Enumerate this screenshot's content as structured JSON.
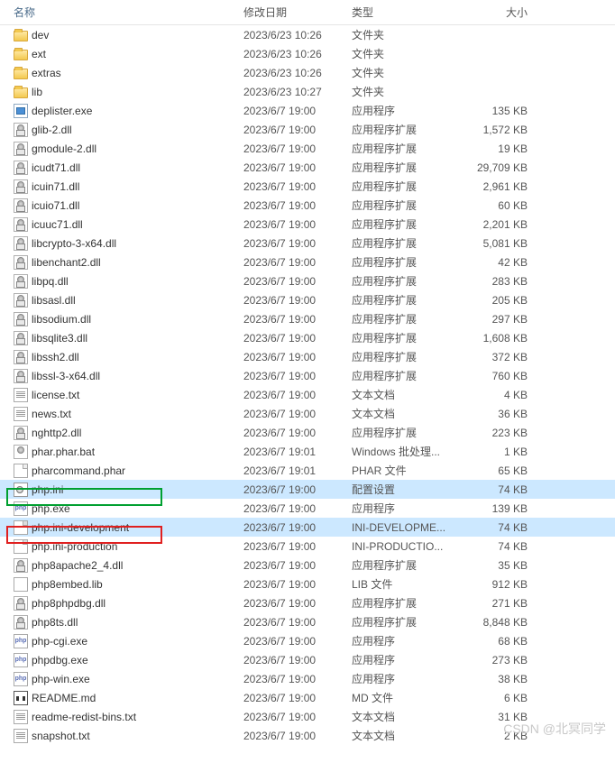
{
  "columns": {
    "name": "名称",
    "date": "修改日期",
    "type": "类型",
    "size": "大小"
  },
  "watermark": "CSDN @北冥同学",
  "files": [
    {
      "name": "dev",
      "date": "2023/6/23 10:26",
      "type": "文件夹",
      "size": "",
      "icon": "folder"
    },
    {
      "name": "ext",
      "date": "2023/6/23 10:26",
      "type": "文件夹",
      "size": "",
      "icon": "folder"
    },
    {
      "name": "extras",
      "date": "2023/6/23 10:26",
      "type": "文件夹",
      "size": "",
      "icon": "folder"
    },
    {
      "name": "lib",
      "date": "2023/6/23 10:27",
      "type": "文件夹",
      "size": "",
      "icon": "folder"
    },
    {
      "name": "deplister.exe",
      "date": "2023/6/7 19:00",
      "type": "应用程序",
      "size": "135 KB",
      "icon": "exe"
    },
    {
      "name": "glib-2.dll",
      "date": "2023/6/7 19:00",
      "type": "应用程序扩展",
      "size": "1,572 KB",
      "icon": "dll"
    },
    {
      "name": "gmodule-2.dll",
      "date": "2023/6/7 19:00",
      "type": "应用程序扩展",
      "size": "19 KB",
      "icon": "dll"
    },
    {
      "name": "icudt71.dll",
      "date": "2023/6/7 19:00",
      "type": "应用程序扩展",
      "size": "29,709 KB",
      "icon": "dll"
    },
    {
      "name": "icuin71.dll",
      "date": "2023/6/7 19:00",
      "type": "应用程序扩展",
      "size": "2,961 KB",
      "icon": "dll"
    },
    {
      "name": "icuio71.dll",
      "date": "2023/6/7 19:00",
      "type": "应用程序扩展",
      "size": "60 KB",
      "icon": "dll"
    },
    {
      "name": "icuuc71.dll",
      "date": "2023/6/7 19:00",
      "type": "应用程序扩展",
      "size": "2,201 KB",
      "icon": "dll"
    },
    {
      "name": "libcrypto-3-x64.dll",
      "date": "2023/6/7 19:00",
      "type": "应用程序扩展",
      "size": "5,081 KB",
      "icon": "dll"
    },
    {
      "name": "libenchant2.dll",
      "date": "2023/6/7 19:00",
      "type": "应用程序扩展",
      "size": "42 KB",
      "icon": "dll"
    },
    {
      "name": "libpq.dll",
      "date": "2023/6/7 19:00",
      "type": "应用程序扩展",
      "size": "283 KB",
      "icon": "dll"
    },
    {
      "name": "libsasl.dll",
      "date": "2023/6/7 19:00",
      "type": "应用程序扩展",
      "size": "205 KB",
      "icon": "dll"
    },
    {
      "name": "libsodium.dll",
      "date": "2023/6/7 19:00",
      "type": "应用程序扩展",
      "size": "297 KB",
      "icon": "dll"
    },
    {
      "name": "libsqlite3.dll",
      "date": "2023/6/7 19:00",
      "type": "应用程序扩展",
      "size": "1,608 KB",
      "icon": "dll"
    },
    {
      "name": "libssh2.dll",
      "date": "2023/6/7 19:00",
      "type": "应用程序扩展",
      "size": "372 KB",
      "icon": "dll"
    },
    {
      "name": "libssl-3-x64.dll",
      "date": "2023/6/7 19:00",
      "type": "应用程序扩展",
      "size": "760 KB",
      "icon": "dll"
    },
    {
      "name": "license.txt",
      "date": "2023/6/7 19:00",
      "type": "文本文档",
      "size": "4 KB",
      "icon": "txt"
    },
    {
      "name": "news.txt",
      "date": "2023/6/7 19:00",
      "type": "文本文档",
      "size": "36 KB",
      "icon": "txt"
    },
    {
      "name": "nghttp2.dll",
      "date": "2023/6/7 19:00",
      "type": "应用程序扩展",
      "size": "223 KB",
      "icon": "dll"
    },
    {
      "name": "phar.phar.bat",
      "date": "2023/6/7 19:01",
      "type": "Windows 批处理...",
      "size": "1 KB",
      "icon": "bat"
    },
    {
      "name": "pharcommand.phar",
      "date": "2023/6/7 19:01",
      "type": "PHAR 文件",
      "size": "65 KB",
      "icon": "phar"
    },
    {
      "name": "php.ini",
      "date": "2023/6/7 19:00",
      "type": "配置设置",
      "size": "74 KB",
      "icon": "ini",
      "selected": true
    },
    {
      "name": "php.exe",
      "date": "2023/6/7 19:00",
      "type": "应用程序",
      "size": "139 KB",
      "icon": "php"
    },
    {
      "name": "php.ini-development",
      "date": "2023/6/7 19:00",
      "type": "INI-DEVELOPME...",
      "size": "74 KB",
      "icon": "file",
      "selected": true
    },
    {
      "name": "php.ini-production",
      "date": "2023/6/7 19:00",
      "type": "INI-PRODUCTIO...",
      "size": "74 KB",
      "icon": "file"
    },
    {
      "name": "php8apache2_4.dll",
      "date": "2023/6/7 19:00",
      "type": "应用程序扩展",
      "size": "35 KB",
      "icon": "dll"
    },
    {
      "name": "php8embed.lib",
      "date": "2023/6/7 19:00",
      "type": "LIB 文件",
      "size": "912 KB",
      "icon": "lib"
    },
    {
      "name": "php8phpdbg.dll",
      "date": "2023/6/7 19:00",
      "type": "应用程序扩展",
      "size": "271 KB",
      "icon": "dll"
    },
    {
      "name": "php8ts.dll",
      "date": "2023/6/7 19:00",
      "type": "应用程序扩展",
      "size": "8,848 KB",
      "icon": "dll"
    },
    {
      "name": "php-cgi.exe",
      "date": "2023/6/7 19:00",
      "type": "应用程序",
      "size": "68 KB",
      "icon": "php"
    },
    {
      "name": "phpdbg.exe",
      "date": "2023/6/7 19:00",
      "type": "应用程序",
      "size": "273 KB",
      "icon": "php"
    },
    {
      "name": "php-win.exe",
      "date": "2023/6/7 19:00",
      "type": "应用程序",
      "size": "38 KB",
      "icon": "php"
    },
    {
      "name": "README.md",
      "date": "2023/6/7 19:00",
      "type": "MD 文件",
      "size": "6 KB",
      "icon": "md"
    },
    {
      "name": "readme-redist-bins.txt",
      "date": "2023/6/7 19:00",
      "type": "文本文档",
      "size": "31 KB",
      "icon": "txt"
    },
    {
      "name": "snapshot.txt",
      "date": "2023/6/7 19:00",
      "type": "文本文档",
      "size": "2 KB",
      "icon": "txt"
    }
  ]
}
